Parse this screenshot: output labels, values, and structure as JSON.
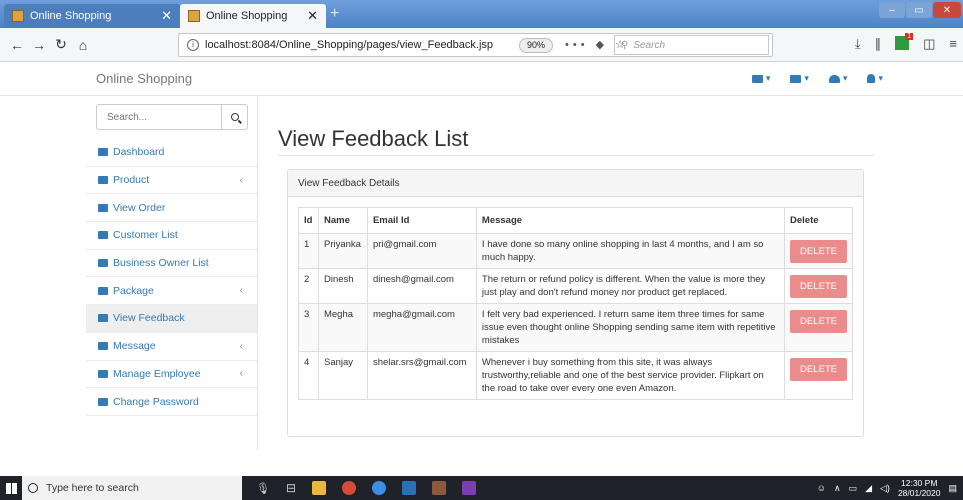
{
  "browser": {
    "tabs": [
      {
        "title": "Online Shopping",
        "active": false
      },
      {
        "title": "Online Shopping",
        "active": true
      }
    ],
    "url": "localhost:8084/Online_Shopping/pages/view_Feedback.jsp",
    "zoom": "90%",
    "url_actions": "••• ◆ ☆",
    "search_placeholder": "Search"
  },
  "app": {
    "brand": "Online Shopping",
    "sidebar_search_placeholder": "Search...",
    "sidebar": [
      {
        "label": "Dashboard",
        "icon": "dashboard-icon",
        "chevron": false,
        "active": false
      },
      {
        "label": "Product",
        "icon": "bar-chart-icon",
        "chevron": true,
        "active": false
      },
      {
        "label": "View Order",
        "icon": "table-icon",
        "chevron": false,
        "active": false
      },
      {
        "label": "Customer List",
        "icon": "table-icon",
        "chevron": false,
        "active": false
      },
      {
        "label": "Business Owner List",
        "icon": "edit-icon",
        "chevron": false,
        "active": false
      },
      {
        "label": "Package",
        "icon": "bar-chart-icon",
        "chevron": true,
        "active": false
      },
      {
        "label": "View Feedback",
        "icon": "edit-icon",
        "chevron": false,
        "active": true
      },
      {
        "label": "Message",
        "icon": "bar-chart-icon",
        "chevron": true,
        "active": false
      },
      {
        "label": "Manage Employee",
        "icon": "bar-chart-icon",
        "chevron": true,
        "active": false
      },
      {
        "label": "Change Password",
        "icon": "edit-icon",
        "chevron": false,
        "active": false
      }
    ],
    "page_title": "View Feedback List",
    "panel_heading": "View Feedback Details",
    "table": {
      "headers": [
        "Id",
        "Name",
        "Email Id",
        "Message",
        "Delete"
      ],
      "rows": [
        {
          "id": "1",
          "name": "Priyanka",
          "email": "pri@gmail.com",
          "message": "I have done so many online shopping in last 4 months, and I am so much happy."
        },
        {
          "id": "2",
          "name": "Dinesh",
          "email": "dinesh@gmail.com",
          "message": "The return or refund policy is different. When the value is more they just play and don't refund money nor product get replaced."
        },
        {
          "id": "3",
          "name": "Megha",
          "email": "megha@gmail.com",
          "message": "I felt very bad experienced. I return same item three times for same issue even thought online Shopping sending same item with repetitive mistakes"
        },
        {
          "id": "4",
          "name": "Sanjay",
          "email": "shelar.srs@gmail.com",
          "message": "Whenever i buy something from this site, it was always trustworthy,reliable and one of the best service provider. Flipkart on the road to take over every one even Amazon."
        }
      ],
      "delete_label": "DELETE"
    },
    "colors": {
      "link": "#337ab7",
      "delete": "#e98c8b"
    }
  },
  "taskbar": {
    "search_placeholder": "Type here to search",
    "time": "12:30 PM",
    "date": "28/01/2020"
  }
}
